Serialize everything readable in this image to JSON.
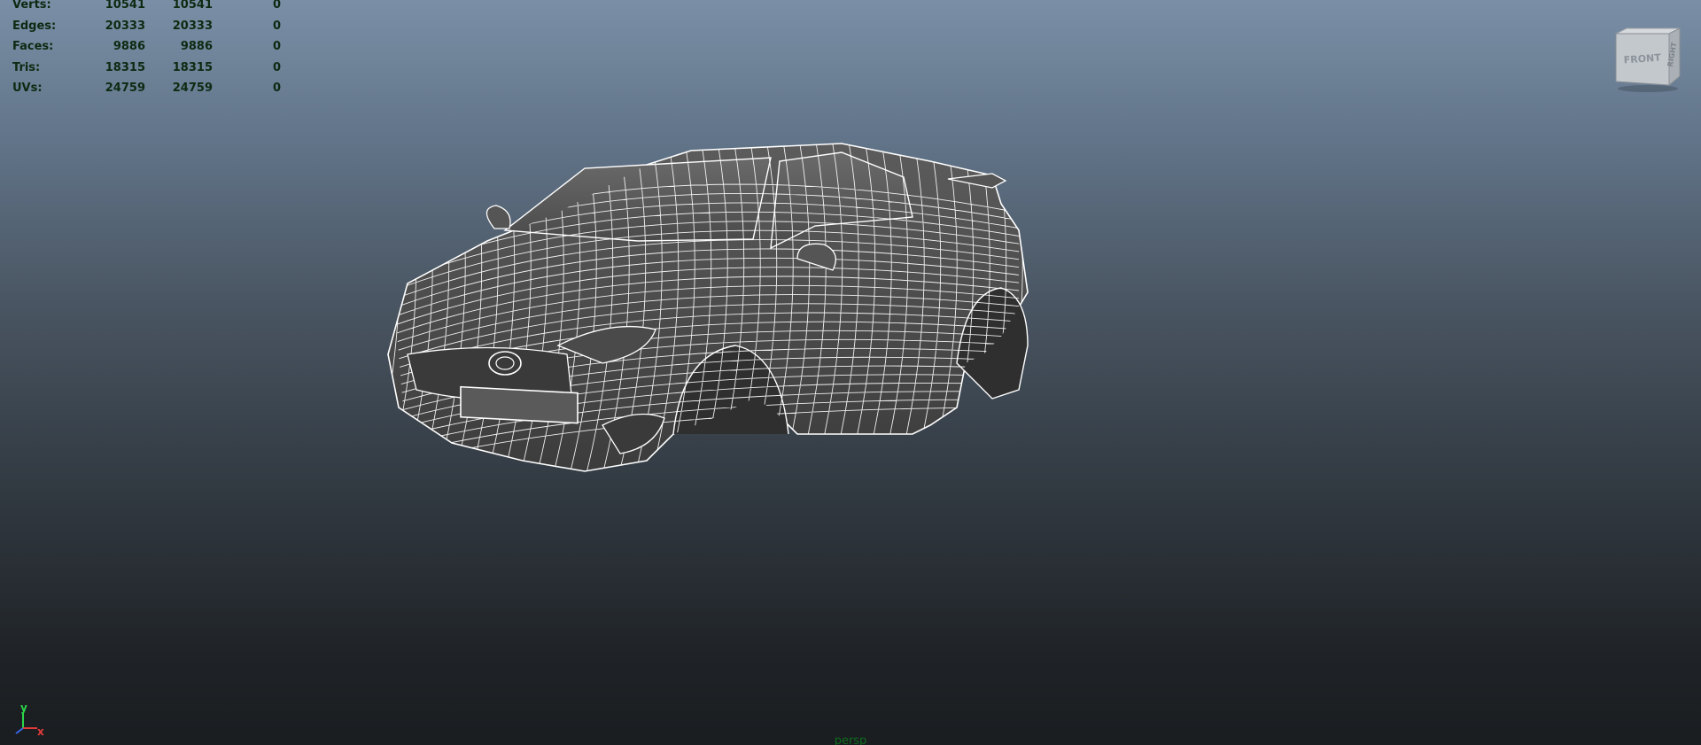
{
  "hud": {
    "rows": [
      {
        "label": "Verts:",
        "v1": "10541",
        "v2": "10541",
        "v3": "0"
      },
      {
        "label": "Edges:",
        "v1": "20333",
        "v2": "20333",
        "v3": "0"
      },
      {
        "label": "Faces:",
        "v1": "9886",
        "v2": "9886",
        "v3": "0"
      },
      {
        "label": "Tris:",
        "v1": "18315",
        "v2": "18315",
        "v3": "0"
      },
      {
        "label": "UVs:",
        "v1": "24759",
        "v2": "24759",
        "v3": "0"
      }
    ]
  },
  "view_cube": {
    "front_label": "FRONT",
    "right_label": "RIGHT"
  },
  "axis": {
    "y_label": "y",
    "x_label": "x",
    "y_color": "#2bd64a",
    "x_color": "#e43a3a",
    "z_color": "#3a66e4"
  },
  "camera": {
    "name": "persp"
  }
}
